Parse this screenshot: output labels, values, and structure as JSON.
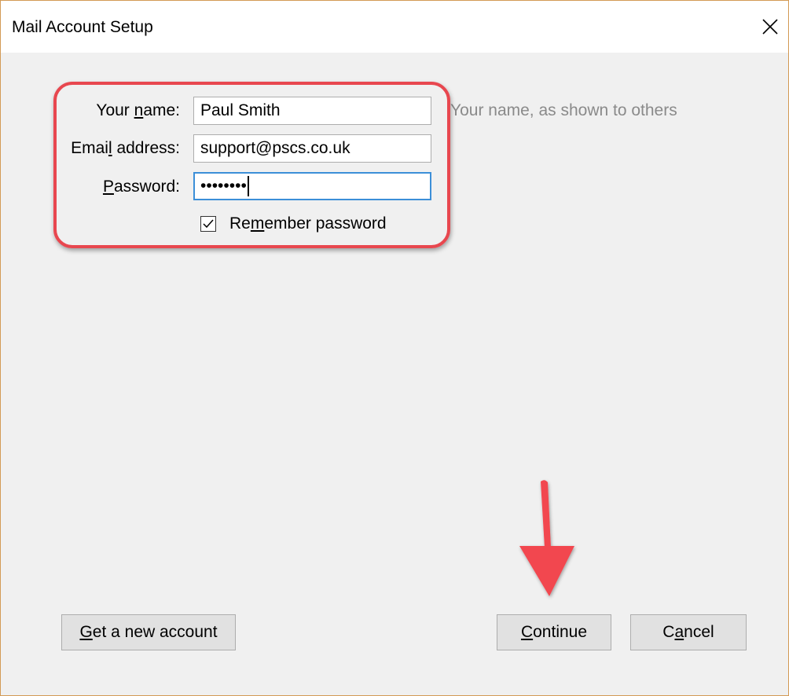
{
  "window": {
    "title": "Mail Account Setup",
    "close_icon": "close-icon"
  },
  "form": {
    "name_label": [
      "Your ",
      "n",
      "ame:"
    ],
    "name_value": "Paul Smith",
    "name_hint": "Your name, as shown to others",
    "email_label": [
      "Emai",
      "l",
      " address:"
    ],
    "email_value": "support@pscs.co.uk",
    "password_label": [
      "",
      "P",
      "assword:"
    ],
    "password_value": "••••••••",
    "remember": {
      "label": [
        "Re",
        "m",
        "ember password"
      ],
      "checked": true
    }
  },
  "buttons": {
    "get_account": [
      "",
      "G",
      "et a new account"
    ],
    "continue": [
      "",
      "C",
      "ontinue"
    ],
    "cancel": [
      "C",
      "a",
      "ncel"
    ]
  },
  "annotations": {
    "highlight_color": "#e8474f",
    "arrow_color": "#f2474f"
  }
}
